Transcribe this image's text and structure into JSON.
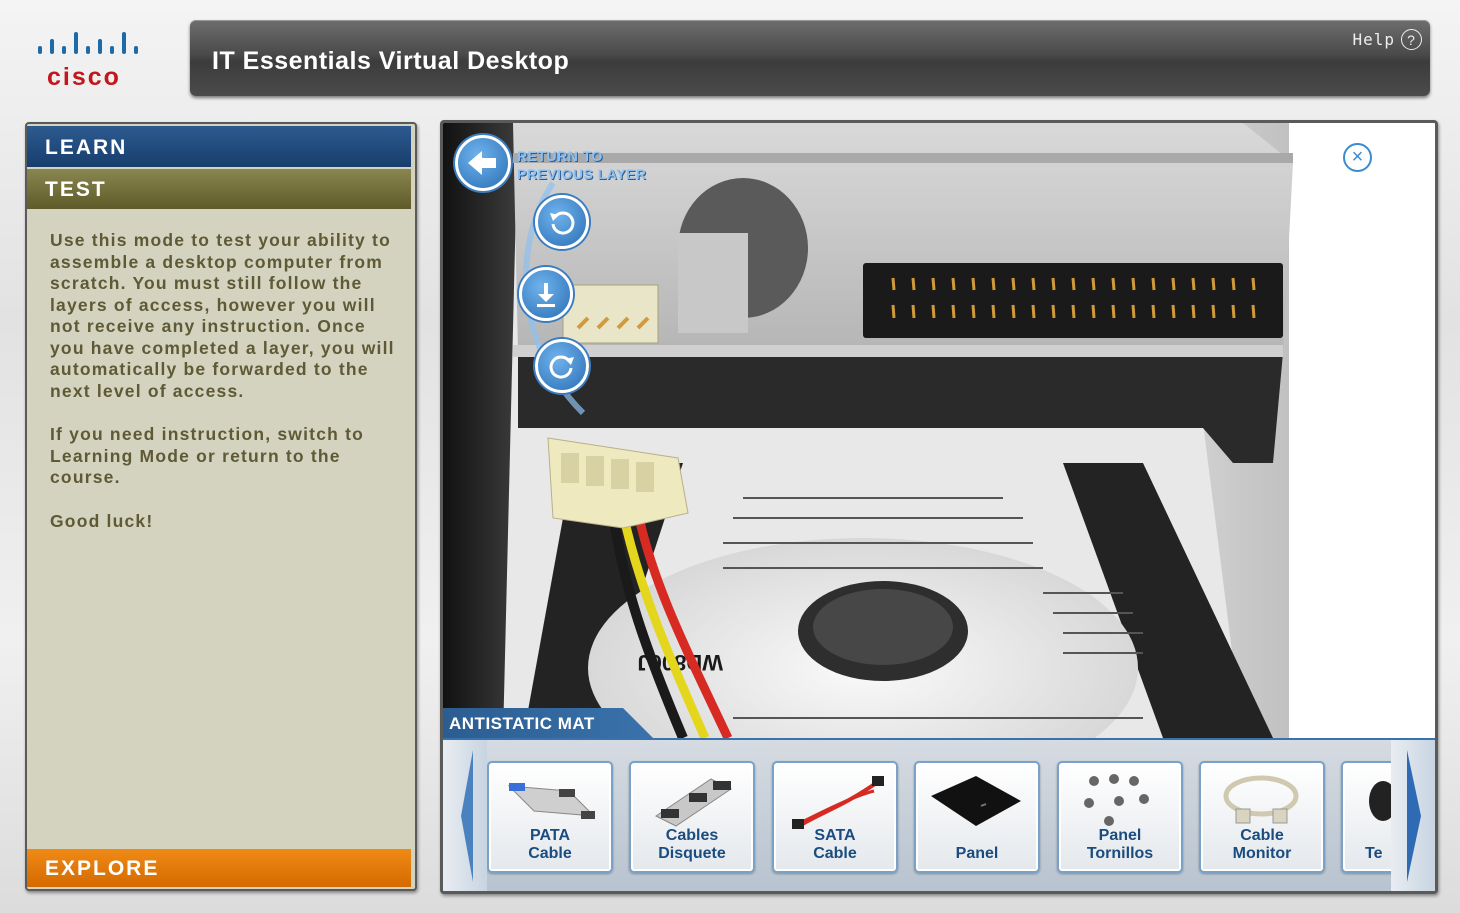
{
  "header": {
    "brand": "cisco",
    "title": "IT Essentials Virtual Desktop",
    "help_label": "Help",
    "help_icon": "?"
  },
  "sidebar": {
    "learn_label": "LEARN",
    "test_label": "TEST",
    "explore_label": "EXPLORE",
    "description": [
      "Use this mode to test your ability to assemble a desktop computer from scratch. You must still follow the layers of access, however you will not receive any instruction. Once you have completed a layer, you will automatically be forwarded to the next level of access.",
      "If you need instruction, switch to Learning Mode or return to the course.",
      "Good luck!"
    ]
  },
  "viewer": {
    "back_label_line1": "RETURN TO",
    "back_label_line2": "PREVIOUS LAYER",
    "close_icon": "×",
    "mat_label": "ANTISTATIC MAT",
    "hdd_label": "WD800J"
  },
  "tray": {
    "items": [
      {
        "line1": "PATA",
        "line2": "Cable"
      },
      {
        "line1": "Cables",
        "line2": "Disquete"
      },
      {
        "line1": "SATA",
        "line2": "Cable"
      },
      {
        "line1": "",
        "line2": "Panel"
      },
      {
        "line1": "Panel",
        "line2": "Tornillos"
      },
      {
        "line1": "Cable",
        "line2": "Monitor"
      },
      {
        "line1": "",
        "line2": "Te"
      }
    ]
  },
  "colors": {
    "learn": "#1f4a7e",
    "test": "#716d3c",
    "explore": "#e87b0c",
    "panel_bg": "#d4d3c0",
    "accent_blue": "#3b8bd0"
  }
}
